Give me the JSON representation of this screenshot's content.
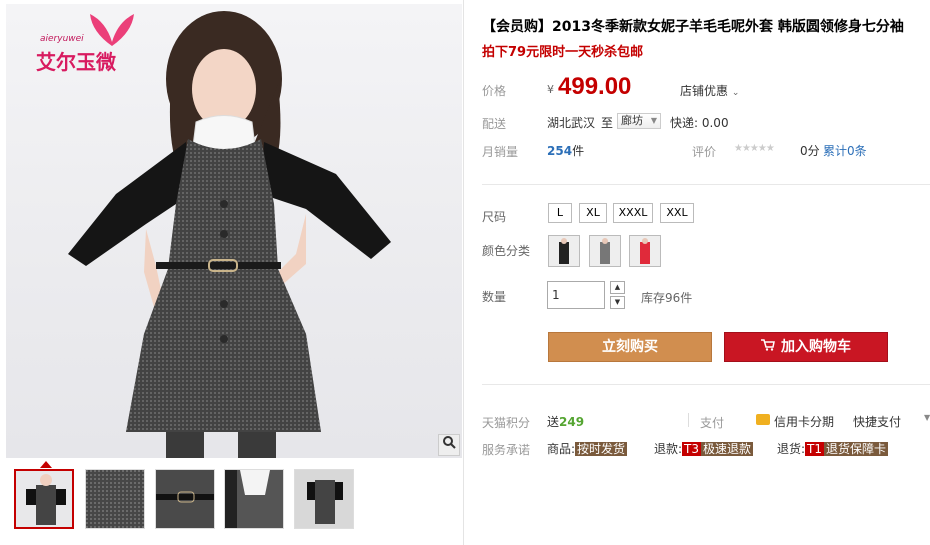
{
  "gallery": {
    "brand_latin": "aieryuwei",
    "brand_name": "艾尔玉微",
    "zoom_icon": "magnifier-icon",
    "thumbnail_count": 5
  },
  "product": {
    "title": "【会员购】2013冬季新款女妮子羊毛毛呢外套 韩版圆领修身七分袖",
    "subtitle": "拍下79元限时一天秒杀包邮"
  },
  "price": {
    "label": "价格",
    "currency": "¥",
    "value": "499.00",
    "promo": "店铺优惠",
    "promo_icon": "chevron-down-icon"
  },
  "shipping": {
    "label": "配送",
    "from": "湖北武汉",
    "to_label": "至",
    "destination": "廊坊",
    "fee": "快递: 0.00"
  },
  "sales": {
    "label": "月销量",
    "count": "254",
    "unit": "件",
    "rating_label": "评价",
    "stars": "★★★★★",
    "score": "0分",
    "cumulative": "累计0条"
  },
  "options": {
    "size_label": "尺码",
    "sizes": [
      "L",
      "XL",
      "XXXL",
      "XXL"
    ],
    "color_label": "颜色分类",
    "colors": [
      "#222222",
      "#777777",
      "#e02a3a"
    ]
  },
  "quantity": {
    "label": "数量",
    "value": "1",
    "stock": "库存96件"
  },
  "actions": {
    "buy_now": "立刻购买",
    "add_to_cart": "加入购物车"
  },
  "services": {
    "points_label": "天猫积分",
    "points_prefix": "送",
    "points": "249",
    "pay_label": "支付",
    "pay_card": "信用卡分期",
    "pay_quick": "快捷支付",
    "promise_label": "服务承诺",
    "goods_label": "商品:",
    "goods_tag": "按时发货",
    "refund_label": "退款:",
    "refund_code": "T3",
    "refund_tag": "极速退款",
    "return_label": "退货:",
    "return_code": "T1",
    "return_tag": "退货保障卡"
  }
}
